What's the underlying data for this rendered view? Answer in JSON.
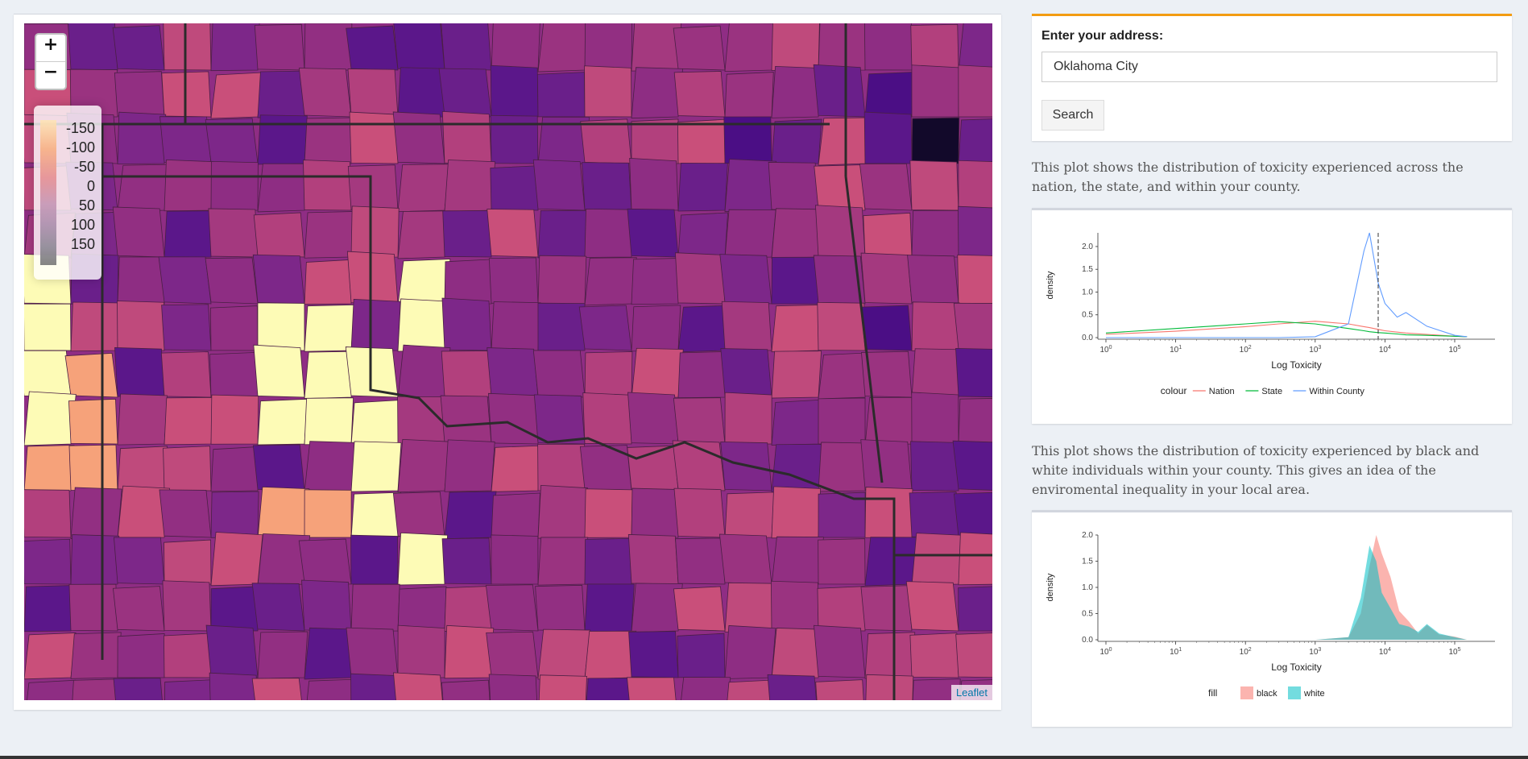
{
  "map": {
    "zoom_in": "+",
    "zoom_out": "−",
    "legend": [
      "-150",
      "-100",
      "-50",
      "0",
      "50",
      "100",
      "150"
    ],
    "attribution": "Leaflet"
  },
  "search": {
    "label": "Enter your address:",
    "value": "Oklahoma City",
    "button": "Search"
  },
  "plot1": {
    "description": "This plot shows the distribution of toxicity experienced across the nation, the state, and within your county.",
    "xlabel": "Log Toxicity",
    "ylabel": "density",
    "yticks": [
      "0.0",
      "0.5",
      "1.0",
      "1.5",
      "2.0"
    ],
    "xticks": [
      "10^0",
      "10^1",
      "10^2",
      "10^3",
      "10^4",
      "10^5"
    ],
    "legend_title": "colour",
    "legend": [
      {
        "name": "Nation",
        "color": "#f8766d"
      },
      {
        "name": "State",
        "color": "#00ba38"
      },
      {
        "name": "Within County",
        "color": "#619cff"
      }
    ]
  },
  "plot2": {
    "description": "This plot shows the distribution of toxicity experienced by black and white individuals within your county. This gives an idea of the enviromental inequality in your local area.",
    "xlabel": "Log Toxicity",
    "ylabel": "density",
    "yticks": [
      "0.0",
      "0.5",
      "1.0",
      "1.5",
      "2.0"
    ],
    "xticks": [
      "10^0",
      "10^1",
      "10^2",
      "10^3",
      "10^4",
      "10^5"
    ],
    "legend_title": "fill",
    "legend": [
      {
        "name": "black",
        "color": "#f8766d"
      },
      {
        "name": "white",
        "color": "#00bfc4"
      }
    ]
  },
  "chart_data": [
    {
      "type": "line",
      "xlabel": "Log Toxicity",
      "ylabel": "density",
      "xscale": "log10",
      "xlim": [
        1,
        100000
      ],
      "ylim": [
        0,
        2.3
      ],
      "reference_line_x": 8000,
      "x": [
        1,
        10,
        100,
        300,
        1000,
        3000,
        5000,
        6000,
        8000,
        10000,
        15000,
        20000,
        40000,
        100000,
        150000
      ],
      "series": [
        {
          "name": "Nation",
          "values": [
            0.07,
            0.14,
            0.24,
            0.3,
            0.36,
            0.3,
            0.24,
            0.22,
            0.18,
            0.15,
            0.12,
            0.1,
            0.07,
            0.03,
            0.02
          ]
        },
        {
          "name": "State",
          "values": [
            0.1,
            0.2,
            0.3,
            0.35,
            0.3,
            0.2,
            0.15,
            0.13,
            0.11,
            0.1,
            0.08,
            0.06,
            0.05,
            0.03,
            0.02
          ]
        },
        {
          "name": "Within County",
          "values": [
            0.0,
            0.0,
            0.0,
            0.0,
            0.02,
            0.3,
            1.9,
            2.3,
            1.2,
            0.75,
            0.45,
            0.55,
            0.25,
            0.05,
            0.02
          ]
        }
      ]
    },
    {
      "type": "area",
      "xlabel": "Log Toxicity",
      "ylabel": "density",
      "xscale": "log10",
      "xlim": [
        1,
        100000
      ],
      "ylim": [
        0,
        2.0
      ],
      "x": [
        1000,
        3000,
        4500,
        6000,
        7500,
        9000,
        12000,
        16000,
        22000,
        30000,
        40000,
        60000,
        100000,
        150000
      ],
      "series": [
        {
          "name": "black",
          "values": [
            0.0,
            0.05,
            0.5,
            1.4,
            2.0,
            1.65,
            1.2,
            0.55,
            0.35,
            0.12,
            0.28,
            0.1,
            0.06,
            0.0
          ]
        },
        {
          "name": "white",
          "values": [
            0.0,
            0.05,
            0.8,
            1.8,
            1.5,
            0.9,
            0.6,
            0.3,
            0.25,
            0.15,
            0.3,
            0.12,
            0.05,
            0.0
          ]
        }
      ]
    }
  ]
}
